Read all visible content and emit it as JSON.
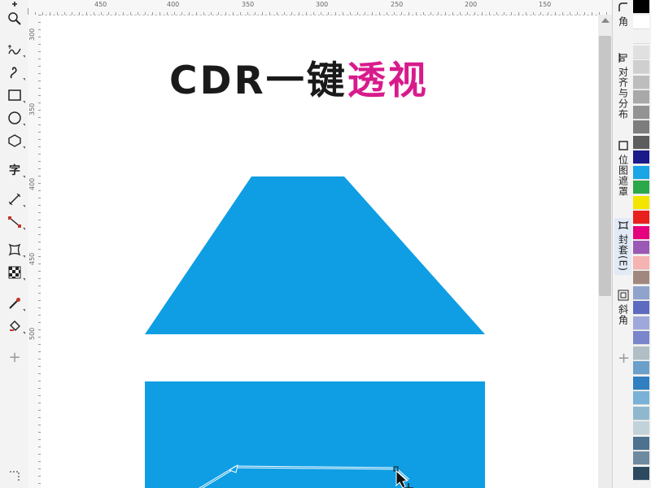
{
  "ruler_top": {
    "labels": [
      "450",
      "400",
      "350",
      "300",
      "250",
      "200",
      "150"
    ],
    "unit": "毫米"
  },
  "ruler_left": {
    "labels": [
      "300",
      "350",
      "400",
      "450",
      "500"
    ]
  },
  "canvas": {
    "title_black": "CDR一键",
    "title_pink": "透视",
    "shape_color": "#0f9ee3"
  },
  "dock_tabs": [
    {
      "label": "角",
      "icon": "corner-icon"
    },
    {
      "label": "对齐与分布",
      "icon": "align-icon"
    },
    {
      "label": "位图遮罩",
      "icon": "bitmap-mask-icon"
    },
    {
      "label": "封套(E)",
      "icon": "envelope-icon"
    },
    {
      "label": "斜角",
      "icon": "bevel-icon"
    }
  ],
  "palette": [
    "#000000",
    "#ffffff",
    "#f2f2f2",
    "#e0e0e0",
    "#cfcfcf",
    "#bdbdbd",
    "#a8a8a8",
    "#939393",
    "#7d7d7d",
    "#5d5d5d",
    "#1a1a8a",
    "#1aa5e6",
    "#2ba84a",
    "#f4e500",
    "#e8211d",
    "#e6007e",
    "#9b59b6",
    "#f7b2b2",
    "#a1887f",
    "#8fa3cc",
    "#5c6bc0",
    "#9fa8da",
    "#7986cb",
    "#b0bec5",
    "#6aa0c9",
    "#2f7fc1",
    "#79b2d6",
    "#8fb8cf",
    "#c2d2d9",
    "#4d7290",
    "#6e8aa0",
    "#2b4a5f"
  ]
}
